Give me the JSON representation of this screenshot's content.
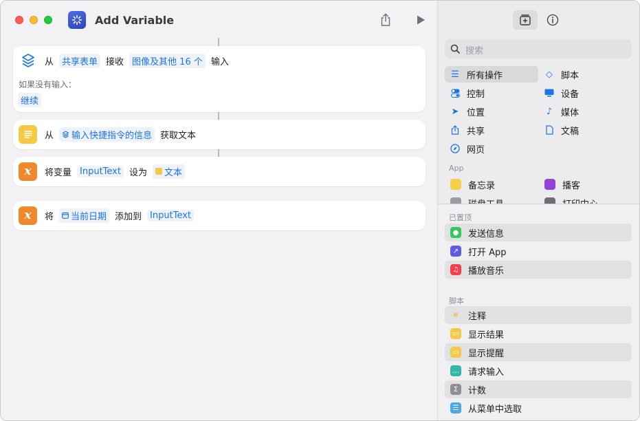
{
  "window": {
    "title": "Add Variable"
  },
  "actions": {
    "receive": {
      "from": "从",
      "source": "共享表单",
      "receive": "接收",
      "types": "图像及其他 16 个",
      "input": "输入",
      "no_input_label": "如果没有输入：",
      "no_input_value": "继续"
    },
    "get_text": {
      "from": "从",
      "source": "输入快捷指令的信息",
      "action": "获取文本"
    },
    "set_variable": {
      "prefix": "将变量",
      "variable": "InputText",
      "set_to": "设为",
      "value": "文本"
    },
    "add_to": {
      "prefix": "将",
      "value": "当前日期",
      "add_to": "添加到",
      "variable": "InputText"
    }
  },
  "sidebar": {
    "search_placeholder": "搜索",
    "categories": [
      {
        "label": "所有操作",
        "icon": "list-icon"
      },
      {
        "label": "脚本",
        "icon": "script-icon"
      },
      {
        "label": "控制",
        "icon": "toggle-icon"
      },
      {
        "label": "设备",
        "icon": "monitor-icon"
      },
      {
        "label": "位置",
        "icon": "location-icon"
      },
      {
        "label": "媒体",
        "icon": "music-note-icon"
      },
      {
        "label": "共享",
        "icon": "share-icon"
      },
      {
        "label": "文稿",
        "icon": "document-icon"
      },
      {
        "label": "网页",
        "icon": "compass-icon"
      }
    ],
    "app_section": "App",
    "apps": [
      {
        "label": "备忘录",
        "icon": "notes-app-icon",
        "color": "#f5d04a"
      },
      {
        "label": "播客",
        "icon": "podcasts-app-icon",
        "color": "#8e44d6"
      },
      {
        "label": "磁盘工具",
        "icon": "disk-utility-app-icon",
        "color": "#9a9aa0"
      },
      {
        "label": "打印中心",
        "icon": "print-center-app-icon",
        "color": "#6e6e73"
      }
    ],
    "pinned_section": "已置顶",
    "pinned": [
      {
        "label": "发送信息",
        "icon": "messages-icon",
        "color": "#34c759"
      },
      {
        "label": "打开 App",
        "icon": "open-app-icon",
        "color": "#5e5ce6"
      },
      {
        "label": "播放音乐",
        "icon": "music-icon",
        "color": "#fa3c4c"
      }
    ],
    "scripting_section": "脚本",
    "scripting": [
      {
        "label": "注释",
        "icon": "comment-icon",
        "color": "#f7c845"
      },
      {
        "label": "显示结果",
        "icon": "show-result-icon",
        "color": "#f7c845"
      },
      {
        "label": "显示提醒",
        "icon": "show-alert-icon",
        "color": "#f7c845"
      },
      {
        "label": "请求输入",
        "icon": "ask-input-icon",
        "color": "#34b7a7"
      },
      {
        "label": "计数",
        "icon": "count-icon",
        "color": "#8e8e93"
      },
      {
        "label": "从菜单中选取",
        "icon": "choose-menu-icon",
        "color": "#4aa8e8"
      }
    ]
  }
}
